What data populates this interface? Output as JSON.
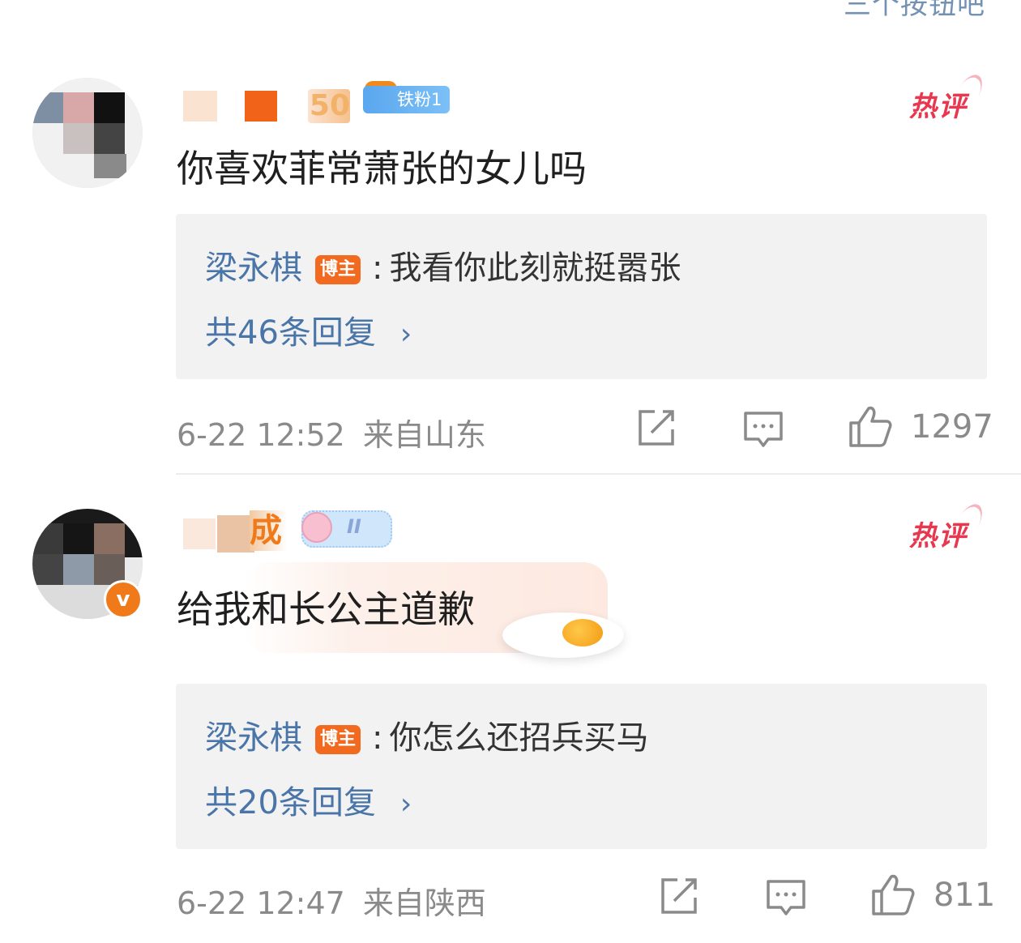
{
  "header": {
    "cut_text": "三个按钮吧"
  },
  "colors": {
    "accent_link": "#4a75a8",
    "hot": "#e8384f",
    "host_badge": "#f26a1f",
    "meta_gray": "#8a8a8a",
    "reply_bg": "#f2f2f2"
  },
  "comments": [
    {
      "name_visible": "50",
      "fan_badge": "铁粉1",
      "hot_label": "热评",
      "text": "你喜欢菲常萧张的女儿吗",
      "reply": {
        "author": "梁永棋",
        "author_badge": "博主",
        "colon": ":",
        "text": "我看你此刻就挺嚣张",
        "count_label": "共46条回复",
        "chevron": "›"
      },
      "date": "6-22 12:52",
      "location": "来自山东",
      "icons": [
        "share-icon",
        "comment-icon",
        "like-icon"
      ],
      "likes": "1297"
    },
    {
      "name_visible": "成",
      "sticker_text": "II",
      "verified_mark": "v",
      "hot_label": "热评",
      "text": "给我和长公主道歉",
      "reply": {
        "author": "梁永棋",
        "author_badge": "博主",
        "colon": ":",
        "text": "你怎么还招兵买马",
        "count_label": "共20条回复",
        "chevron": "›"
      },
      "date": "6-22 12:47",
      "location": "来自陕西",
      "icons": [
        "share-icon",
        "comment-icon",
        "like-icon"
      ],
      "likes": "811"
    }
  ]
}
